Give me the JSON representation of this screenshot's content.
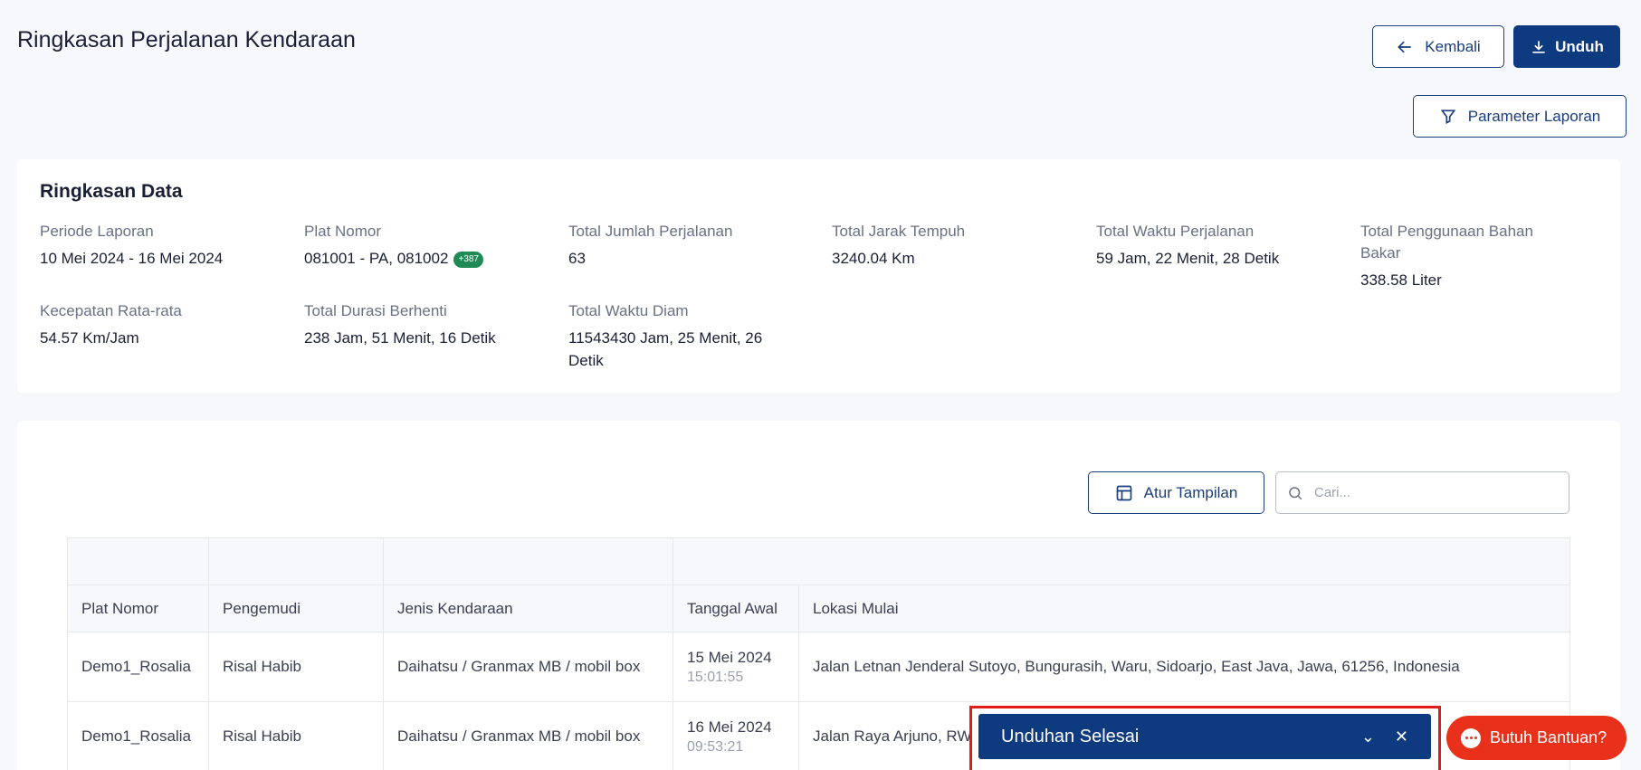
{
  "header": {
    "title": "Ringkasan Perjalanan Kendaraan",
    "back_label": "Kembali",
    "download_label": "Unduh",
    "param_label": "Parameter Laporan"
  },
  "summary": {
    "title": "Ringkasan Data",
    "fields": [
      {
        "label": "Periode Laporan",
        "value": "10 Mei 2024 - 16 Mei 2024"
      },
      {
        "label": "Plat Nomor",
        "value": "081001 - PA, 081002",
        "badge": "+387"
      },
      {
        "label": "Total Jumlah Perjalanan",
        "value": "63"
      },
      {
        "label": "Total Jarak Tempuh",
        "value": "3240.04 Km"
      },
      {
        "label": "Total Waktu Perjalanan",
        "value": "59 Jam, 22 Menit, 28 Detik"
      },
      {
        "label": "Total Penggunaan Bahan Bakar",
        "value": "338.58 Liter"
      },
      {
        "label": "Kecepatan Rata-rata",
        "value": "54.57 Km/Jam"
      },
      {
        "label": "Total Durasi Berhenti",
        "value": "238 Jam, 51 Menit, 16 Detik"
      },
      {
        "label": "Total Waktu Diam",
        "value": "11543430 Jam, 25 Menit, 26 Detik"
      }
    ]
  },
  "toolbar": {
    "atur_label": "Atur Tampilan",
    "search_placeholder": "Cari..."
  },
  "table": {
    "columns": [
      "Plat Nomor",
      "Pengemudi",
      "Jenis Kendaraan",
      "Tanggal Awal",
      "Lokasi Mulai"
    ],
    "rows": [
      {
        "plat": "Demo1_Rosalia",
        "driver": "Risal Habib",
        "type": "Daihatsu / Granmax MB / mobil box",
        "date": "15 Mei 2024",
        "time": "15:01:55",
        "location": "Jalan Letnan Jenderal Sutoyo, Bungurasih, Waru, Sidoarjo, East Java, Jawa, 61256, Indonesia"
      },
      {
        "plat": "Demo1_Rosalia",
        "driver": "Risal Habib",
        "type": "Daihatsu / Granmax MB / mobil box",
        "date": "16 Mei 2024",
        "time": "09:53:21",
        "location": "Jalan Raya Arjuno, RW"
      }
    ]
  },
  "toast": {
    "title": "Unduhan Selesai"
  },
  "help": {
    "label": "Butuh Bantuan?"
  },
  "colors": {
    "primary": "#0e3a80",
    "danger": "#e8301a",
    "badge": "#1f8a56"
  }
}
